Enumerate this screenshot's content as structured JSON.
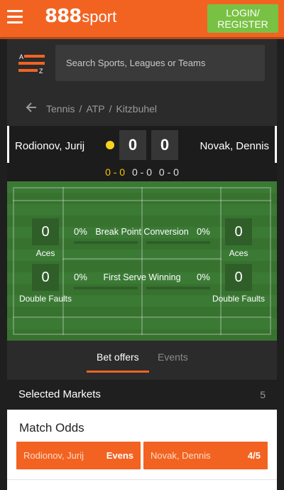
{
  "header": {
    "logo_number": "888",
    "logo_word": "sport",
    "login_line1": "LOGIN/",
    "login_line2": "REGISTER"
  },
  "search": {
    "placeholder": "Search Sports, Leagues or Teams",
    "az_top": "A",
    "az_bottom": "Z"
  },
  "breadcrumb": [
    "Tennis",
    "ATP",
    "Kitzbuhel"
  ],
  "match": {
    "player_home": "Rodionov, Jurij",
    "player_away": "Novak, Dennis",
    "score_home": "0",
    "score_away": "0",
    "sets": [
      "0 - 0",
      "0 - 0",
      "0 - 0"
    ]
  },
  "stats": {
    "aces_label": "Aces",
    "double_faults_label": "Double Faults",
    "home_aces": "0",
    "away_aces": "0",
    "home_double_faults": "0",
    "away_double_faults": "0",
    "break_point_title": "Break Point Conversion",
    "break_point_home_pct": "0%",
    "break_point_away_pct": "0%",
    "first_serve_title": "First Serve Winning",
    "first_serve_home_pct": "0%",
    "first_serve_away_pct": "0%"
  },
  "tabs": {
    "bet_offers": "Bet offers",
    "events": "Events"
  },
  "markets": {
    "title": "Selected Markets",
    "count": "5"
  },
  "match_odds": {
    "title": "Match Odds",
    "home_name": "Rodionov, Jurij",
    "home_price": "Evens",
    "away_name": "Novak, Dennis",
    "away_price": "4/5"
  },
  "colors": {
    "brand_orange": "#f26322",
    "login_green": "#79c143",
    "serve_dot": "#f7d31e",
    "court_green": "#3b7a35"
  }
}
